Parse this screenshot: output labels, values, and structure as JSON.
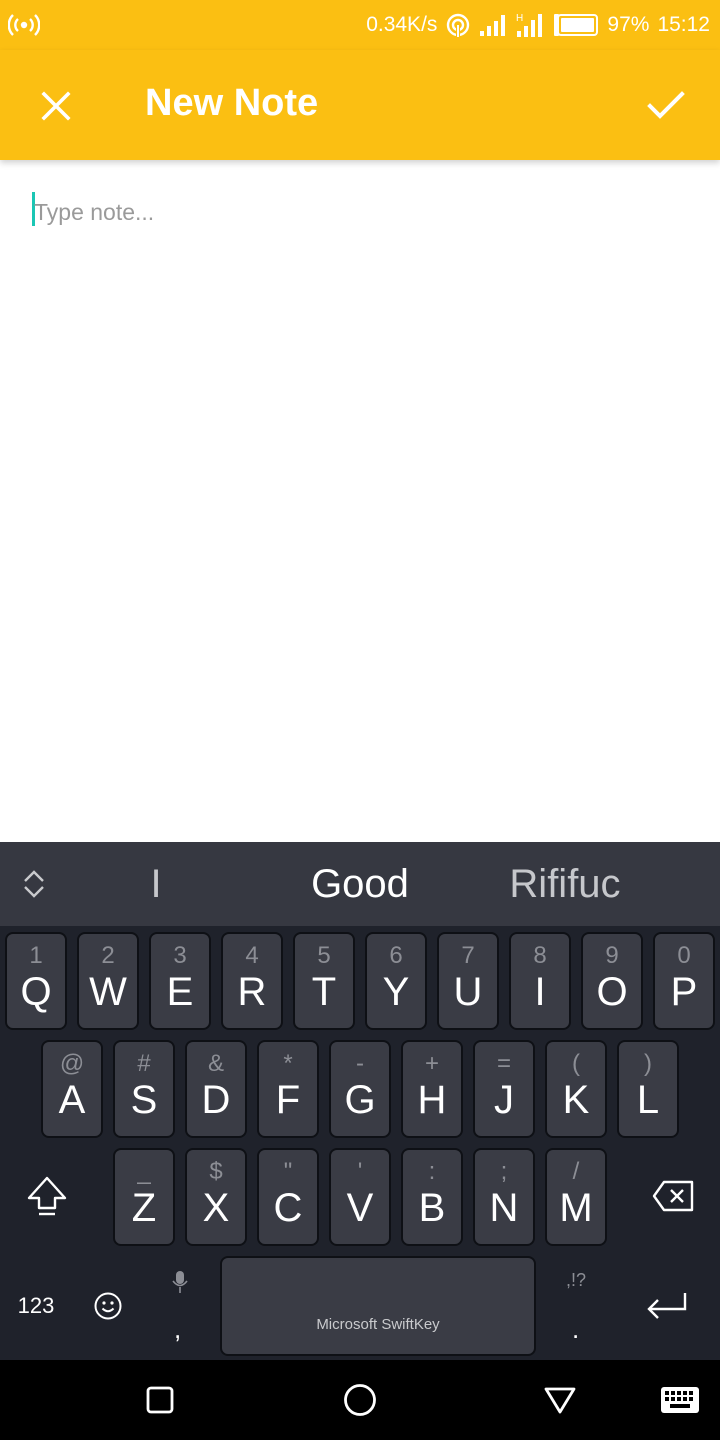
{
  "status_bar": {
    "network_speed": "0.34K/s",
    "battery_percent": "97%",
    "time": "15:12",
    "icons": [
      "hotspot-icon",
      "wifi-icon",
      "signal-icon",
      "signal-h-icon",
      "battery-icon"
    ]
  },
  "app_bar": {
    "title": "New Note",
    "close_icon": "close-icon",
    "save_icon": "check-icon",
    "background": "#fbbf12"
  },
  "editor": {
    "placeholder": "Type note...",
    "value": "",
    "caret_color": "#1bc6b4"
  },
  "keyboard": {
    "suggestions": [
      "I",
      "Good",
      "Rififuc"
    ],
    "rows": [
      [
        {
          "hint": "1",
          "key": "Q"
        },
        {
          "hint": "2",
          "key": "W"
        },
        {
          "hint": "3",
          "key": "E"
        },
        {
          "hint": "4",
          "key": "R"
        },
        {
          "hint": "5",
          "key": "T"
        },
        {
          "hint": "6",
          "key": "Y"
        },
        {
          "hint": "7",
          "key": "U"
        },
        {
          "hint": "8",
          "key": "I"
        },
        {
          "hint": "9",
          "key": "O"
        },
        {
          "hint": "0",
          "key": "P"
        }
      ],
      [
        {
          "hint": "@",
          "key": "A"
        },
        {
          "hint": "#",
          "key": "S"
        },
        {
          "hint": "&",
          "key": "D"
        },
        {
          "hint": "*",
          "key": "F"
        },
        {
          "hint": "-",
          "key": "G"
        },
        {
          "hint": "+",
          "key": "H"
        },
        {
          "hint": "=",
          "key": "J"
        },
        {
          "hint": "(",
          "key": "K"
        },
        {
          "hint": ")",
          "key": "L"
        }
      ],
      [
        {
          "hint": "_",
          "key": "Z"
        },
        {
          "hint": "$",
          "key": "X"
        },
        {
          "hint": "\"",
          "key": "C"
        },
        {
          "hint": "'",
          "key": "V"
        },
        {
          "hint": ":",
          "key": "B"
        },
        {
          "hint": ";",
          "key": "N"
        },
        {
          "hint": "/",
          "key": "M"
        }
      ]
    ],
    "numbers_label": "123",
    "comma_label": ",",
    "period_label": ".",
    "punct_hint": ",!?",
    "space_brand": "Microsoft SwiftKey"
  },
  "nav_bar": {
    "items": [
      "recents-square-icon",
      "home-circle-icon",
      "back-triangle-icon",
      "keyboard-icon"
    ]
  }
}
